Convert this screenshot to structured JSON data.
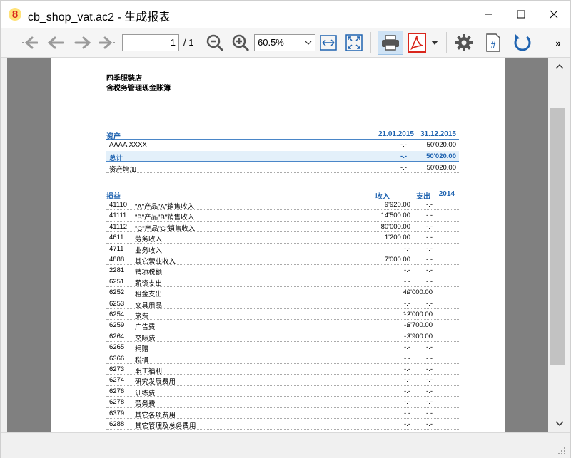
{
  "window": {
    "title": "cb_shop_vat.ac2 - 生成报表",
    "app_icon": "banana-8-icon",
    "accent_color": "#1f63b0",
    "acrobat_color": "#d9261c"
  },
  "toolbar": {
    "page_current": "1",
    "page_total": "/ 1",
    "zoom": "60.5%",
    "more": "»"
  },
  "report": {
    "company": "四季服装店",
    "subtitle": "含税务管理现金账簿",
    "assets": {
      "heading": "资产",
      "col1": "21.01.2015",
      "col2": "31.12.2015",
      "rows": [
        {
          "label": "AAAA    XXXX",
          "v1": "-.-",
          "v2": "50'020.00"
        }
      ],
      "total": {
        "label": "总计",
        "v1": "-.-",
        "v2": "50'020.00"
      },
      "increase": {
        "label": "资产增加",
        "v1": "-.-",
        "v2": "50'020.00"
      }
    },
    "pl": {
      "heading": "损益",
      "col_income": "收入",
      "col_expense": "支出",
      "col_year": "2014",
      "rows": [
        {
          "acct": "41110",
          "desc": "\"A\"产品\"A\"销售收入",
          "income": "9'920.00",
          "expense": "-.-"
        },
        {
          "acct": "41111",
          "desc": "\"B\"产品\"B\"销售收入",
          "income": "14'500.00",
          "expense": "-.-"
        },
        {
          "acct": "41112",
          "desc": "\"C\"产品\"C\"销售收入",
          "income": "80'000.00",
          "expense": "-.-"
        },
        {
          "acct": "4611",
          "desc": "劳务收入",
          "income": "1'200.00",
          "expense": "-.-"
        },
        {
          "acct": "4711",
          "desc": "业务收入",
          "income": "-.-",
          "expense": "-.-"
        },
        {
          "acct": "4888",
          "desc": "其它营业收入",
          "income": "7'000.00",
          "expense": "-.-"
        },
        {
          "acct": "2281",
          "desc": "销项税额",
          "income": "-.-",
          "expense": "-.-"
        },
        {
          "acct": "6251",
          "desc": "薪资支出",
          "income": "-.-",
          "expense": "-.-"
        },
        {
          "acct": "6252",
          "desc": "租金支出",
          "income": "-.-",
          "expense": "40'000.00"
        },
        {
          "acct": "6253",
          "desc": "文具用品",
          "income": "-.-",
          "expense": "-.-"
        },
        {
          "acct": "6254",
          "desc": "旅费",
          "income": "-.-",
          "expense": "12'000.00"
        },
        {
          "acct": "6259",
          "desc": "广告费",
          "income": "-.-",
          "expense": "6'700.00"
        },
        {
          "acct": "6264",
          "desc": "交际费",
          "income": "-.-",
          "expense": "3'900.00"
        },
        {
          "acct": "6265",
          "desc": "捐赠",
          "income": "-.-",
          "expense": "-.-"
        },
        {
          "acct": "6366",
          "desc": "税捐",
          "income": "-.-",
          "expense": "-.-"
        },
        {
          "acct": "6273",
          "desc": "职工福利",
          "income": "-.-",
          "expense": "-.-"
        },
        {
          "acct": "6274",
          "desc": "研究发展费用",
          "income": "-.-",
          "expense": "-.-"
        },
        {
          "acct": "6276",
          "desc": "训练费",
          "income": "-.-",
          "expense": "-.-"
        },
        {
          "acct": "6278",
          "desc": "劳务费",
          "income": "-.-",
          "expense": "-.-"
        },
        {
          "acct": "6379",
          "desc": "其它各项费用",
          "income": "-.-",
          "expense": "-.-"
        },
        {
          "acct": "6288",
          "desc": "其它管理及总务费用",
          "income": "-.-",
          "expense": "-.-"
        }
      ]
    }
  }
}
